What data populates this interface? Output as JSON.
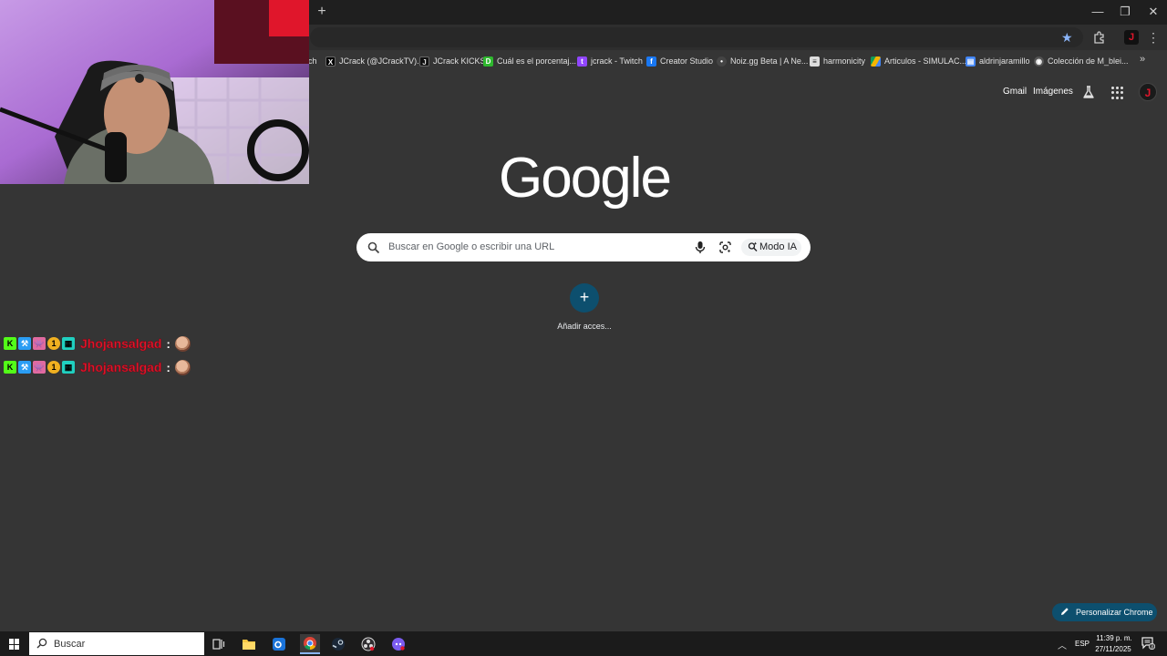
{
  "browser": {
    "new_tab_label": "+",
    "window_controls": {
      "minimize": "—",
      "restore": "❐",
      "close": "✕"
    },
    "profile_letter": "J",
    "bookmarks": [
      {
        "label": "ch",
        "icon": "twitch-icon",
        "color": "#9146ff"
      },
      {
        "label": "JCrack (@JCrackTV)...",
        "icon": "x-icon",
        "color": "#000000"
      },
      {
        "label": "JCrack KICKS",
        "icon": "jcrack-icon",
        "color": "#111111"
      },
      {
        "label": "Cuál es el porcentaj...",
        "icon": "d-icon",
        "color": "#2eb82e"
      },
      {
        "label": "jcrack - Twitch",
        "icon": "twitch-icon",
        "color": "#9146ff"
      },
      {
        "label": "Creator Studio",
        "icon": "facebook-icon",
        "color": "#1877f2"
      },
      {
        "label": "Noiz.gg Beta | A Ne...",
        "icon": "noiz-icon",
        "color": "#444444"
      },
      {
        "label": "harmonicity",
        "icon": "harmonicity-icon",
        "color": "#dddddd"
      },
      {
        "label": "Articulos - SIMULAC...",
        "icon": "drive-icon",
        "color": "#f4b400"
      },
      {
        "label": "aldrinjaramillo",
        "icon": "doc-icon",
        "color": "#4285f4"
      },
      {
        "label": "Colección de M_blei...",
        "icon": "github-icon",
        "color": "#555555"
      }
    ]
  },
  "google": {
    "gmail": "Gmail",
    "images": "Imágenes",
    "logo": "Google",
    "search_placeholder": "Buscar en Google o escribir una URL",
    "ai_mode": "Modo IA",
    "add_shortcut_label": "Añadir acces...",
    "customize_label": "Personalizar Chrome"
  },
  "chat": {
    "messages": [
      {
        "user": "Jhojansalgad",
        "colon": ":"
      },
      {
        "user": "Jhojansalgad",
        "colon": ":"
      }
    ],
    "badges": [
      {
        "text": "K",
        "color": "#53fc18"
      },
      {
        "text": "⚒",
        "color": "#2a9df4"
      },
      {
        "text": "👾",
        "color": "#e06aa0"
      },
      {
        "text": "1",
        "color": "#f0b020"
      },
      {
        "text": "▦",
        "color": "#20d0c0"
      }
    ]
  },
  "taskbar": {
    "search_text": "Buscar",
    "language": "ESP",
    "time": "11:39 p. m.",
    "date": "27/11/2025",
    "notification_count": "3"
  }
}
